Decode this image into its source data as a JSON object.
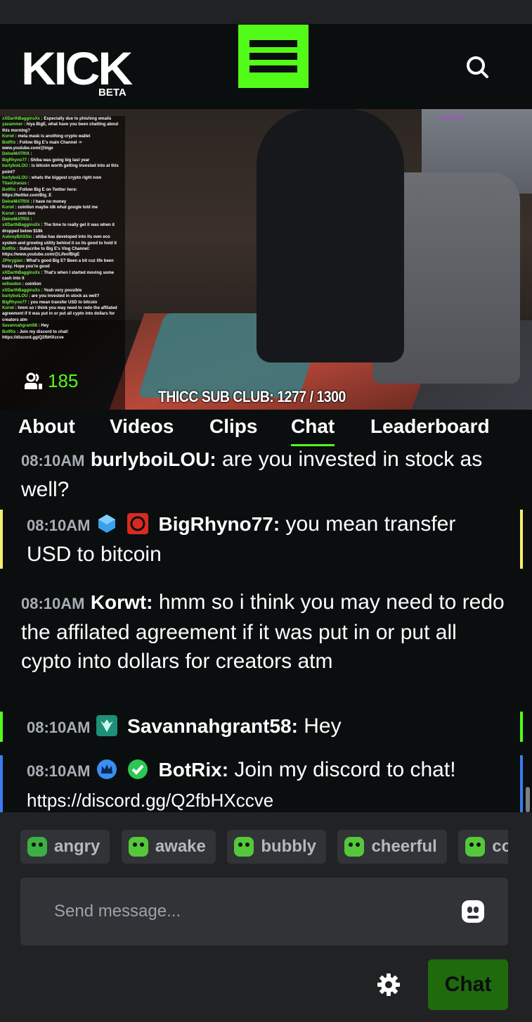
{
  "header": {
    "logo_text": "KICK",
    "logo_sub": "BETA",
    "menu_icon": "hamburger-menu-icon",
    "search_icon": "search-icon",
    "accent": "#53fc18"
  },
  "stream": {
    "viewer_count": "185",
    "sub_goal": "THICC SUB CLUB: 1277 / 1300",
    "last_sub": "Last sub: ...",
    "overlay_chat": [
      {
        "user": "xXDarthBagginsXx",
        "text": "Especially due to phishing emails"
      },
      {
        "user": "yazammer",
        "text": "hiya BigE, what have you been chatting about this morning?"
      },
      {
        "user": "Korwt",
        "text": "meta mask is anothing crypto wallet"
      },
      {
        "user": "BotRix",
        "text": "Follow Big E's main Channel -> www.youtube.com/@bige"
      },
      {
        "user": "DeIneMATRIX",
        "text": ""
      },
      {
        "user": "BigRhyno77",
        "text": "Shiba was going big last year"
      },
      {
        "user": "burlyboiLOU",
        "text": "is bitcoin worth getting invested into at this point?"
      },
      {
        "user": "burlyboiLOU",
        "text": "whats the biggest crypto right now"
      },
      {
        "user": "TitanUranus",
        "text": ""
      },
      {
        "user": "BotRix",
        "text": "Follow Big E on Twitter here: https://twitter.com/Big_E"
      },
      {
        "user": "DeIneMATRIX",
        "text": "I have no money"
      },
      {
        "user": "Korwt",
        "text": "coinlion maybe idk what google told me"
      },
      {
        "user": "Korwt",
        "text": "coin lion"
      },
      {
        "user": "DeIneMATRIX",
        "text": ""
      },
      {
        "user": "xXDarthBagginsXx",
        "text": "The time to really get it was when it dropped below $18k"
      },
      {
        "user": "AubreyBASSic",
        "text": "shiba has developed into its own eco system and growing utility behind it so its good to hold it"
      },
      {
        "user": "BotRix",
        "text": "Subscribe to Big E's Vlog Channel: https://www.youtube.com/@LifeofBigE"
      },
      {
        "user": "JPhrygian",
        "text": "What's good Big E? Been a bit cuz life been busy. Hope you're good"
      },
      {
        "user": "xXDarthBagginsXx",
        "text": "That's when I started moving some cash into it"
      },
      {
        "user": "willsedon",
        "text": "coinlion"
      },
      {
        "user": "xXDarthBagginsXx",
        "text": "Yeah very possible"
      },
      {
        "user": "burlyboiLOU",
        "text": "are you invested in stock as well?"
      },
      {
        "user": "BigRhyno77",
        "text": "you mean transfer USD to bitcoin"
      },
      {
        "user": "Korwt",
        "text": "hmm so i think you may need to redo the affilated agreement if it was put in or put all cypto into dollars for creators atm"
      },
      {
        "user": "Savannahgrant58",
        "text": "Hey"
      },
      {
        "user": "BotRix",
        "text": "Join my discord to chat! https://discord.gg/Q2fbHXccve"
      }
    ]
  },
  "tabs": [
    {
      "label": "About"
    },
    {
      "label": "Videos"
    },
    {
      "label": "Clips"
    },
    {
      "label": "Chat",
      "active": true
    },
    {
      "label": "Leaderboard"
    }
  ],
  "chat": {
    "messages": [
      {
        "time": "08:10AM",
        "user": "burlyboiLOU:",
        "text": "are you invested in stock as well?",
        "highlight": ""
      },
      {
        "time": "08:10AM",
        "user": "BigRhyno77:",
        "text": "you mean transfer USD to bitcoin",
        "highlight": "#f5f06a",
        "badges": [
          "sub-gift-badge",
          "og-badge"
        ]
      },
      {
        "time": "08:10AM",
        "user": "Korwt:",
        "text": "hmm so i think you may need to redo the affilated agreement if it was put in or put all cypto into dollars for creators atm",
        "highlight": ""
      },
      {
        "time": "08:10AM",
        "user": "Savannahgrant58:",
        "text": "Hey",
        "highlight": "#53fc18",
        "badges": [
          "subscriber-badge"
        ]
      },
      {
        "time": "08:10AM",
        "user": "BotRix:",
        "text": "Join my discord to chat!",
        "link": "https://discord.gg/Q2fbHXccve",
        "highlight": "#3a7bf0",
        "badges": [
          "crown-badge",
          "verified-badge"
        ]
      }
    ]
  },
  "composer": {
    "emotes": [
      "angry",
      "awake",
      "bubbly",
      "cheerful",
      "coo"
    ],
    "placeholder": "Send message...",
    "send_label": "Chat",
    "settings_icon": "gear-icon",
    "emoji_icon": "emoji-icon"
  }
}
